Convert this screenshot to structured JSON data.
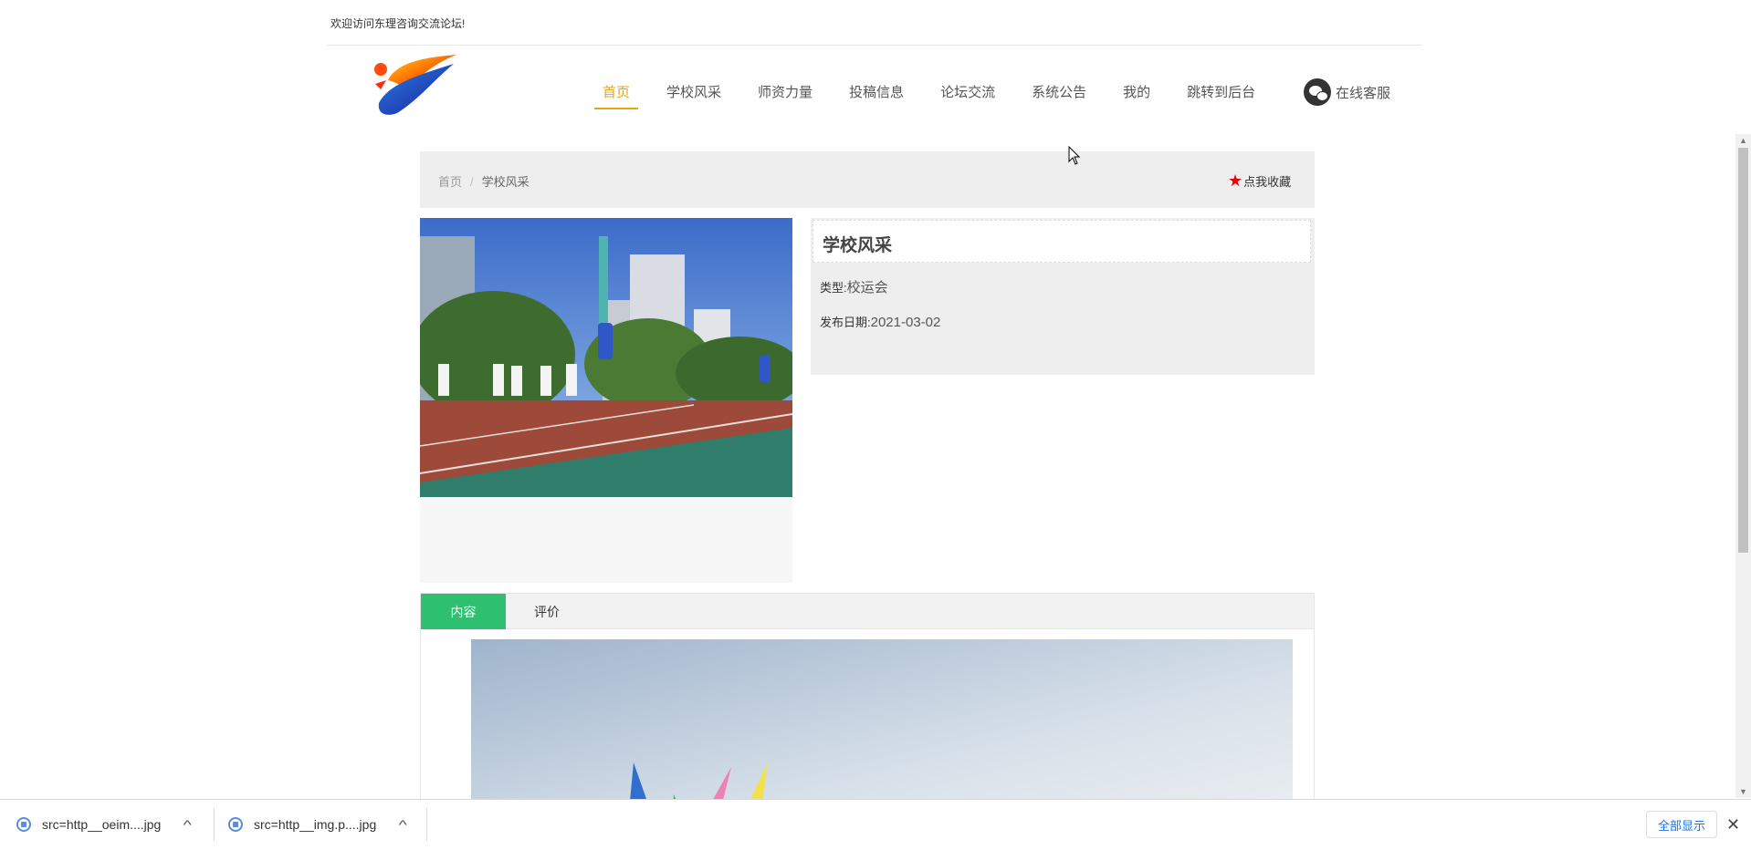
{
  "header": {
    "welcome": "欢迎访问东理咨询交流论坛!",
    "nav": [
      "首页",
      "学校风采",
      "师资力量",
      "投稿信息",
      "论坛交流",
      "系统公告",
      "我的",
      "跳转到后台"
    ],
    "nav_active_index": 0,
    "service_label": "在线客服"
  },
  "breadcrumb": {
    "home": "首页",
    "separator": "/",
    "current": "学校风采"
  },
  "favorite_label": "点我收藏",
  "detail": {
    "title": "学校风采",
    "type_label": "类型:",
    "type_value": "校运会",
    "date_label": "发布日期:",
    "date_value": "2021-03-02"
  },
  "tabs": {
    "content": "内容",
    "review": "评价"
  },
  "downloads": {
    "items": [
      "src=http__oeim....jpg",
      "src=http__img.p....jpg"
    ],
    "show_all": "全部显示"
  },
  "colors": {
    "nav_active": "#e6a419",
    "tab_active": "#2fbf71",
    "star": "#e60012"
  }
}
